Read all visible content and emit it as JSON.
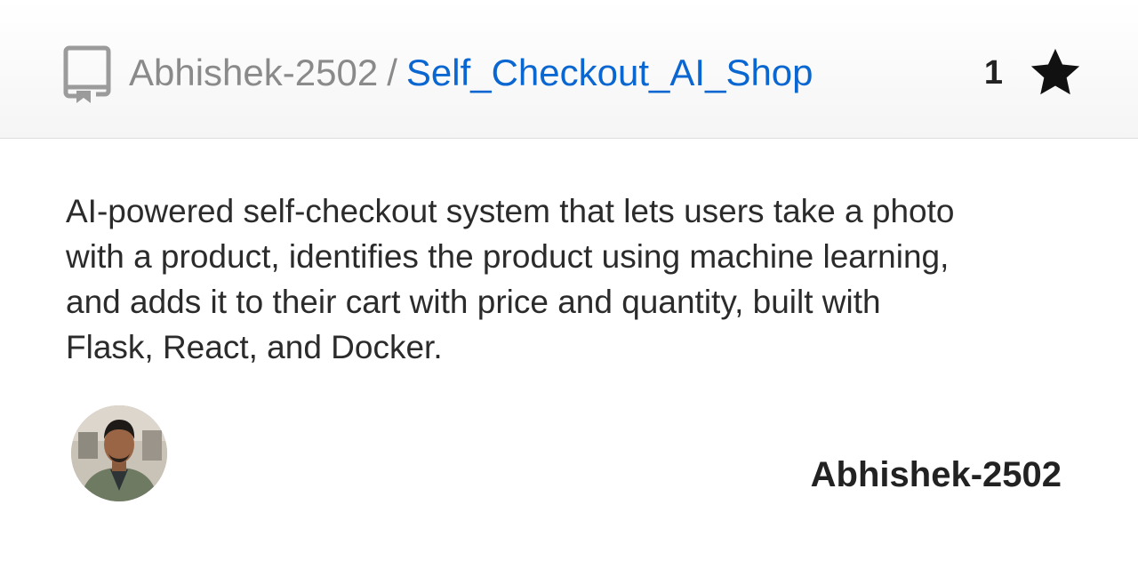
{
  "header": {
    "owner": "Abhishek-2502",
    "separator": "/",
    "repo_name": "Self_Checkout_AI_Shop",
    "star_count": "1",
    "repo_icon": "repo-book-icon",
    "star_icon": "star-icon"
  },
  "description": "AI-powered self-checkout system that lets users take a photo with a product, identifies the product using machine learning, and adds it to their cart with price and quantity, built with Flask, React, and Docker.",
  "author": {
    "name": "Abhishek-2502"
  },
  "colors": {
    "link": "#0a66d0",
    "muted": "#8a8a8a",
    "text": "#2b2b2b"
  }
}
